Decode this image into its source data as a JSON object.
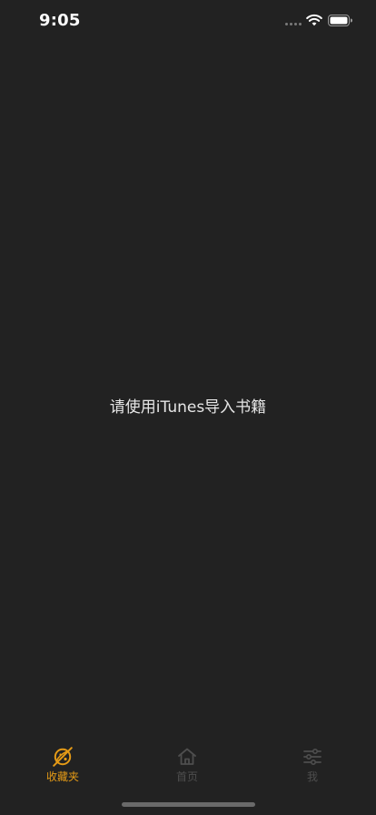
{
  "status_bar": {
    "time": "9:05",
    "icons": [
      "cellular-signal-icon",
      "wifi-icon",
      "battery-icon"
    ]
  },
  "main": {
    "empty_message": "请使用iTunes导入书籍"
  },
  "tab_bar": {
    "accent_color": "#e49a16",
    "inactive_color": "#4e4e4e",
    "items": [
      {
        "label": "收藏夹",
        "icon": "planet-icon",
        "active": true
      },
      {
        "label": "首页",
        "icon": "home-icon",
        "active": false
      },
      {
        "label": "我",
        "icon": "sliders-icon",
        "active": false
      }
    ]
  },
  "colors": {
    "background": "#222222",
    "text": "#e6e6e6"
  }
}
